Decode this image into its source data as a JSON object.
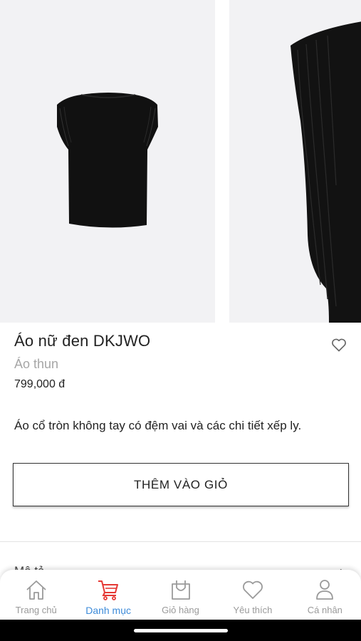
{
  "product": {
    "name": "Áo nữ đen DKJWO",
    "category": "Áo thun",
    "price": "799,000 đ",
    "description": "Áo cổ tròn không tay có đệm vai và các chi tiết xếp ly."
  },
  "actions": {
    "add_to_cart": "THÊM VÀO GIỎ"
  },
  "section": {
    "label": "Mô tả",
    "chevron": "›"
  },
  "tabbar": {
    "active_color": "#e53935",
    "active_label_color": "#3d8bd9",
    "items": [
      {
        "label": "Trang chủ",
        "icon": "home-icon"
      },
      {
        "label": "Danh mục",
        "icon": "cart-icon",
        "active": true
      },
      {
        "label": "Giỏ hàng",
        "icon": "shopping-bag-icon"
      },
      {
        "label": "Yêu thích",
        "icon": "heart-icon"
      },
      {
        "label": "Cá nhân",
        "icon": "user-icon"
      }
    ]
  }
}
